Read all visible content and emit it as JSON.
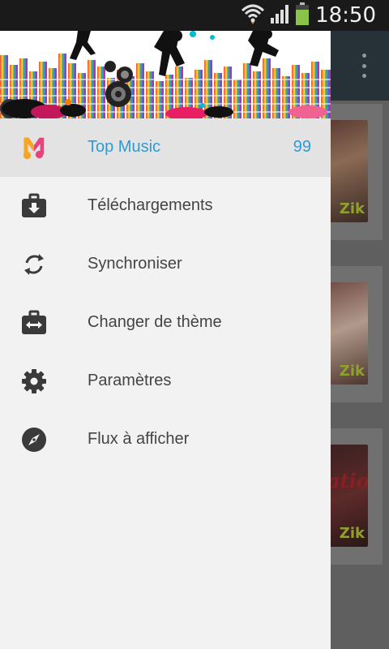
{
  "status_bar": {
    "time": "18:50",
    "icons": [
      "wifi-icon",
      "signal-icon",
      "battery-icon"
    ],
    "battery_color": "#8bc34a"
  },
  "app": {
    "toolbar_color": "#263238",
    "overflow_icon": "more-vert-icon",
    "cards": [
      {
        "thumb_text": "Zik"
      },
      {
        "thumb_text": "Zik"
      },
      {
        "thumb_text": "Zik",
        "thumb_title": "ation"
      }
    ]
  },
  "drawer": {
    "header_image": "music-equalizer-dancers-banner",
    "items": [
      {
        "label": "Top Music",
        "count": "99",
        "icon": "music-app-icon",
        "active": true
      },
      {
        "label": "Téléchargements",
        "icon": "download-icon"
      },
      {
        "label": "Synchroniser",
        "icon": "sync-icon"
      },
      {
        "label": "Changer de thème",
        "icon": "swap-theme-icon"
      },
      {
        "label": "Paramètres",
        "icon": "gear-icon"
      },
      {
        "label": "Flux à afficher",
        "icon": "compass-icon"
      }
    ],
    "accent_color": "#2e9bd6"
  }
}
